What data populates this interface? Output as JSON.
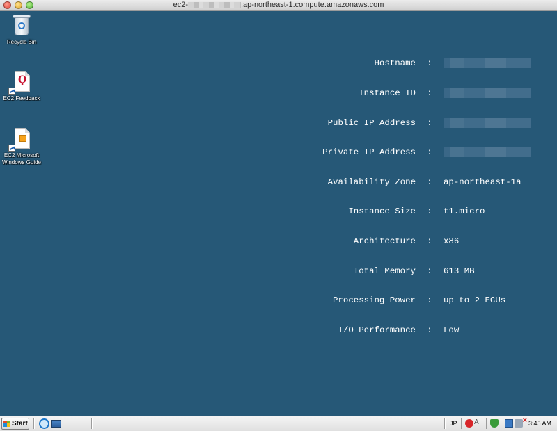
{
  "window": {
    "title_prefix": "ec2-",
    "title_suffix": ".ap-northeast-1.compute.amazonaws.com"
  },
  "desktop": {
    "icons": [
      {
        "label": "Recycle Bin",
        "icon": "recycle-bin-icon"
      },
      {
        "label": "EC2 Feedback",
        "icon": "ec2-feedback-icon"
      },
      {
        "label": "EC2 Microsoft Windows Guide",
        "icon": "ec2-windows-guide-icon"
      }
    ],
    "background_color": "#265877"
  },
  "instance_info": {
    "separator": ":",
    "rows": [
      {
        "label": "Hostname",
        "value": ""
      },
      {
        "label": "Instance ID",
        "value": ""
      },
      {
        "label": "Public IP Address",
        "value": ""
      },
      {
        "label": "Private IP Address",
        "value": ""
      },
      {
        "label": "Availability Zone",
        "value": "ap-northeast-1a"
      },
      {
        "label": "Instance Size",
        "value": "t1.micro"
      },
      {
        "label": "Architecture",
        "value": "x86"
      },
      {
        "label": "Total Memory",
        "value": "613 MB"
      },
      {
        "label": "Processing Power",
        "value": "up to 2 ECUs"
      },
      {
        "label": "I/O Performance",
        "value": "Low"
      }
    ]
  },
  "taskbar": {
    "start_label": "Start",
    "language": "JP",
    "clock": "3:45 AM",
    "help_glyph": "A"
  }
}
